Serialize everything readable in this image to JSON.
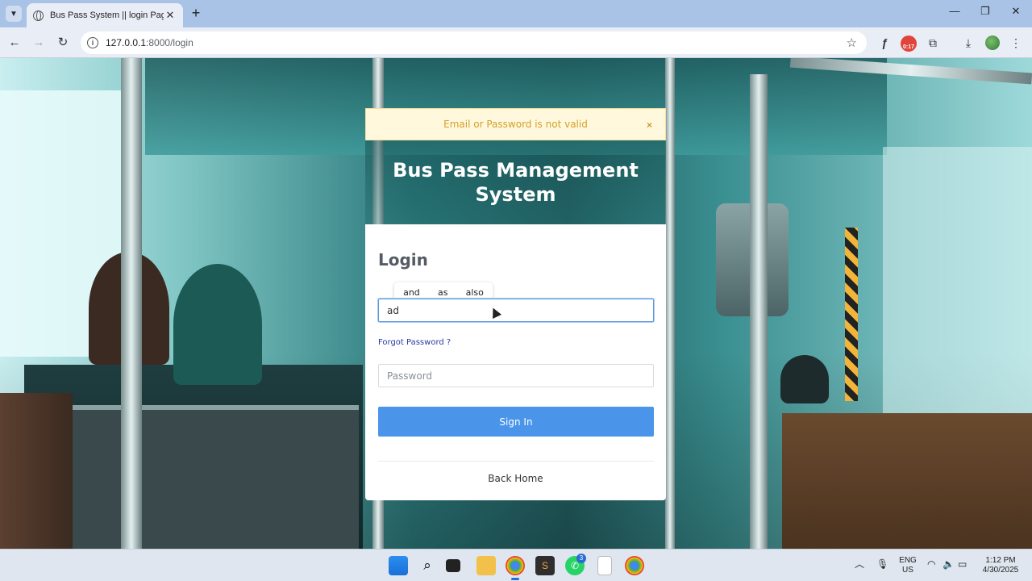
{
  "browser": {
    "tab_title": "Bus Pass System || login Page",
    "tab_close": "✕",
    "new_tab": "+",
    "url_host": "127.0.0.1",
    "url_path": ":8000/login",
    "extension_badge": "0:17",
    "window_controls": [
      "—",
      "❐",
      "✕"
    ]
  },
  "page": {
    "alert_message": "Email or Password is not valid",
    "alert_close": "×",
    "hero_title": "Bus Pass Management System",
    "login": {
      "heading": "Login",
      "email_value": "ad",
      "password_placeholder": "Password",
      "forgot_label": "Forgot Password ?",
      "signin_label": "Sign In",
      "back_home_label": "Back Home"
    },
    "autocomplete_suggestions": [
      "and",
      "as",
      "also"
    ]
  },
  "taskbar": {
    "language": "ENG",
    "region": "US",
    "time": "1:12 PM",
    "date": "4/30/2025",
    "whatsapp_badge": "3"
  },
  "colors": {
    "signin_button": "#4a95ea",
    "alert_text": "#d2a12b",
    "alert_bg": "#fff8dc",
    "link": "#2b3aa0"
  },
  "icons": [
    "chevron-down-icon",
    "globe-icon",
    "back-arrow-icon",
    "forward-arrow-icon",
    "reload-icon",
    "info-icon",
    "star-icon",
    "extensions-icon",
    "download-icon",
    "more-icon",
    "windows-start-icon",
    "search-icon",
    "file-explorer-icon",
    "chrome-icon",
    "whatsapp-icon",
    "wifi-icon",
    "volume-icon",
    "battery-icon",
    "microphone-icon"
  ]
}
